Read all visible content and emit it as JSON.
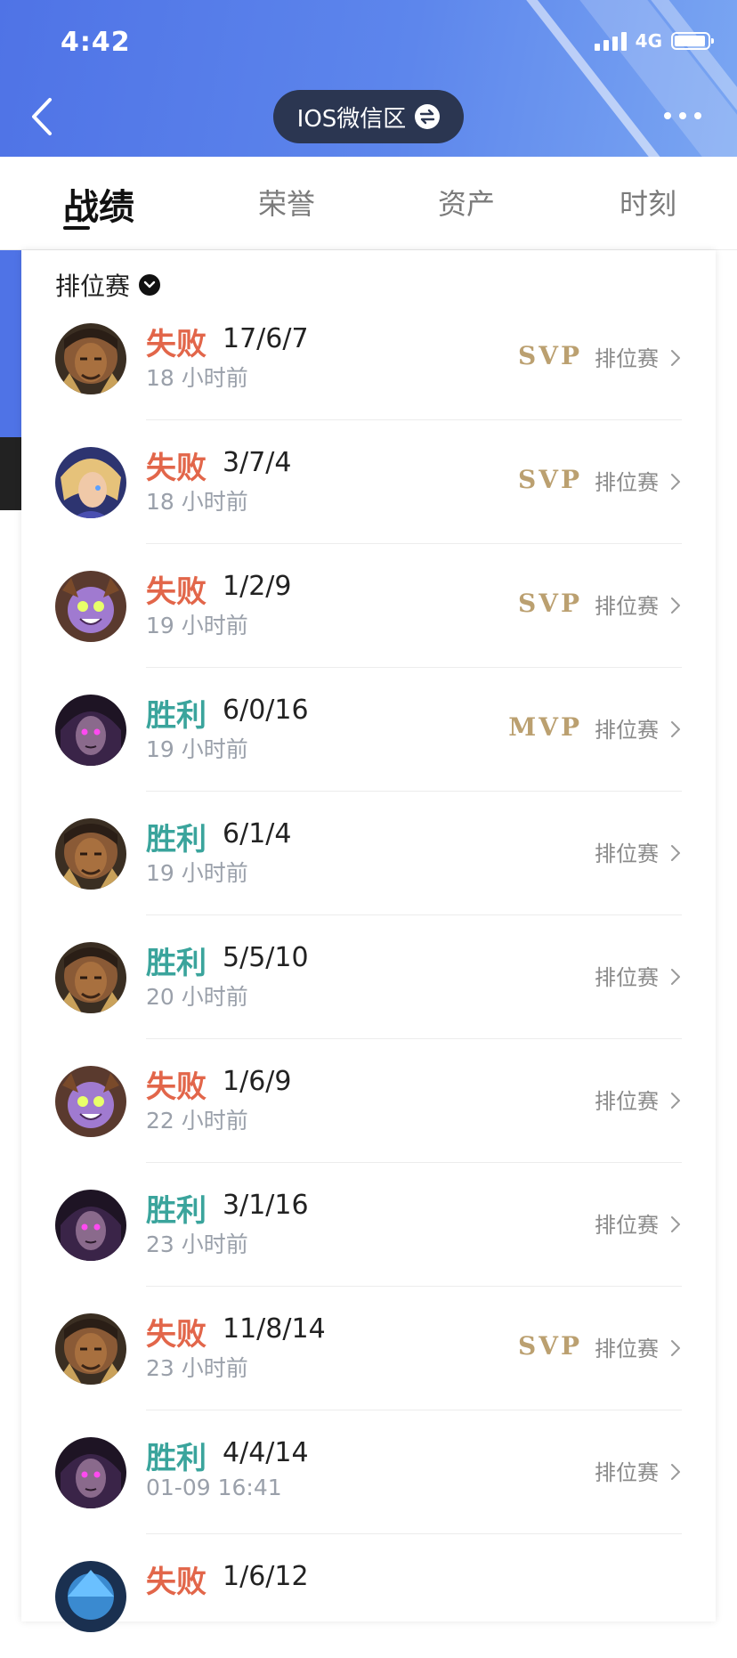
{
  "status_bar": {
    "time": "4:42",
    "network": "4G"
  },
  "header": {
    "server": "IOS微信区"
  },
  "tabs": [
    {
      "label": "战绩",
      "active": true
    },
    {
      "label": "荣誉",
      "active": false
    },
    {
      "label": "资产",
      "active": false
    },
    {
      "label": "时刻",
      "active": false
    }
  ],
  "filter": {
    "label": "排位赛"
  },
  "matches": [
    {
      "result": "失败",
      "outcome": "lose",
      "kda": "17/6/7",
      "time": "18 小时前",
      "badge": "SVP",
      "mode": "排位赛",
      "hero": "warrior"
    },
    {
      "result": "失败",
      "outcome": "lose",
      "kda": "3/7/4",
      "time": "18 小时前",
      "badge": "SVP",
      "mode": "排位赛",
      "hero": "blonde"
    },
    {
      "result": "失败",
      "outcome": "lose",
      "kda": "1/2/9",
      "time": "19 小时前",
      "badge": "SVP",
      "mode": "排位赛",
      "hero": "imp"
    },
    {
      "result": "胜利",
      "outcome": "win",
      "kda": "6/0/16",
      "time": "19 小时前",
      "badge": "MVP",
      "mode": "排位赛",
      "hero": "witch"
    },
    {
      "result": "胜利",
      "outcome": "win",
      "kda": "6/1/4",
      "time": "19 小时前",
      "badge": "",
      "mode": "排位赛",
      "hero": "warrior"
    },
    {
      "result": "胜利",
      "outcome": "win",
      "kda": "5/5/10",
      "time": "20 小时前",
      "badge": "",
      "mode": "排位赛",
      "hero": "warrior"
    },
    {
      "result": "失败",
      "outcome": "lose",
      "kda": "1/6/9",
      "time": "22 小时前",
      "badge": "",
      "mode": "排位赛",
      "hero": "imp"
    },
    {
      "result": "胜利",
      "outcome": "win",
      "kda": "3/1/16",
      "time": "23 小时前",
      "badge": "",
      "mode": "排位赛",
      "hero": "witch"
    },
    {
      "result": "失败",
      "outcome": "lose",
      "kda": "11/8/14",
      "time": "23 小时前",
      "badge": "SVP",
      "mode": "排位赛",
      "hero": "warrior"
    },
    {
      "result": "胜利",
      "outcome": "win",
      "kda": "4/4/14",
      "time": "01-09 16:41",
      "badge": "",
      "mode": "排位赛",
      "hero": "witch"
    },
    {
      "result": "失败",
      "outcome": "lose",
      "kda": "1/6/12",
      "time": "",
      "badge": "",
      "mode": "",
      "hero": "blue"
    }
  ],
  "colors": {
    "header_blue": "#4f73e6",
    "lose": "#e2664a",
    "win": "#3aa49c",
    "badge_gold": "#bba070"
  },
  "icons": [
    "back-icon",
    "swap-icon",
    "more-icon",
    "dropdown-icon",
    "chevron-right-icon",
    "signal-icon",
    "battery-icon"
  ]
}
